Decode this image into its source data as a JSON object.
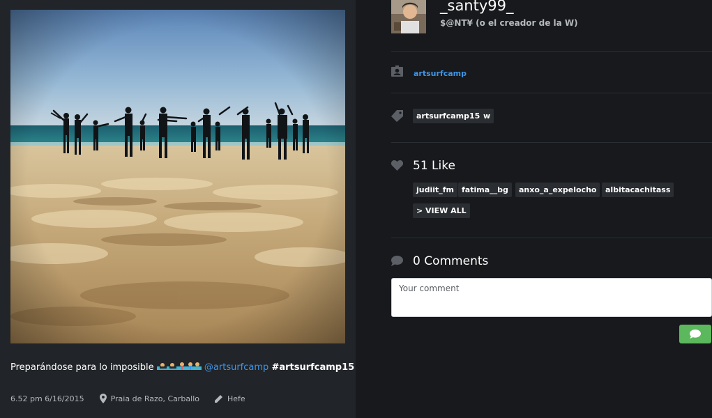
{
  "post": {
    "caption": {
      "text": "Preparándose para lo imposible",
      "mention": "@artsurfcamp",
      "hashtags": "#artsurfcamp15 #w"
    },
    "meta": {
      "time": "6.52 pm 6/16/2015",
      "location": "Praia de Razo, Carballo",
      "filter": "Hefe"
    }
  },
  "profile": {
    "username": "_santy99_",
    "fullname": "$@NT¥ (o el creador de la W)"
  },
  "users_in_photo": {
    "items": [
      "artsurfcamp"
    ]
  },
  "tags": {
    "items": [
      "artsurfcamp15",
      "w"
    ]
  },
  "likes": {
    "title": "51 Like",
    "users": [
      "judiit_fm",
      "fatima__bg",
      "anxo_a_expelocho",
      "albitacachitass"
    ],
    "view_all": "> VIEW ALL"
  },
  "comments": {
    "title": "0 Comments",
    "placeholder": "Your comment"
  },
  "colors": {
    "link": "#3e95e8",
    "send": "#5cb85c",
    "panel_left": "#212428",
    "panel_right": "#17191c"
  },
  "icons": {
    "user_in_photo": "portrait-icon",
    "tags": "tag-icon",
    "likes": "heart-icon",
    "comments": "speech-bubble-icon",
    "location": "map-pin-icon",
    "filter": "pencil-icon",
    "send": "send-comment-icon"
  }
}
